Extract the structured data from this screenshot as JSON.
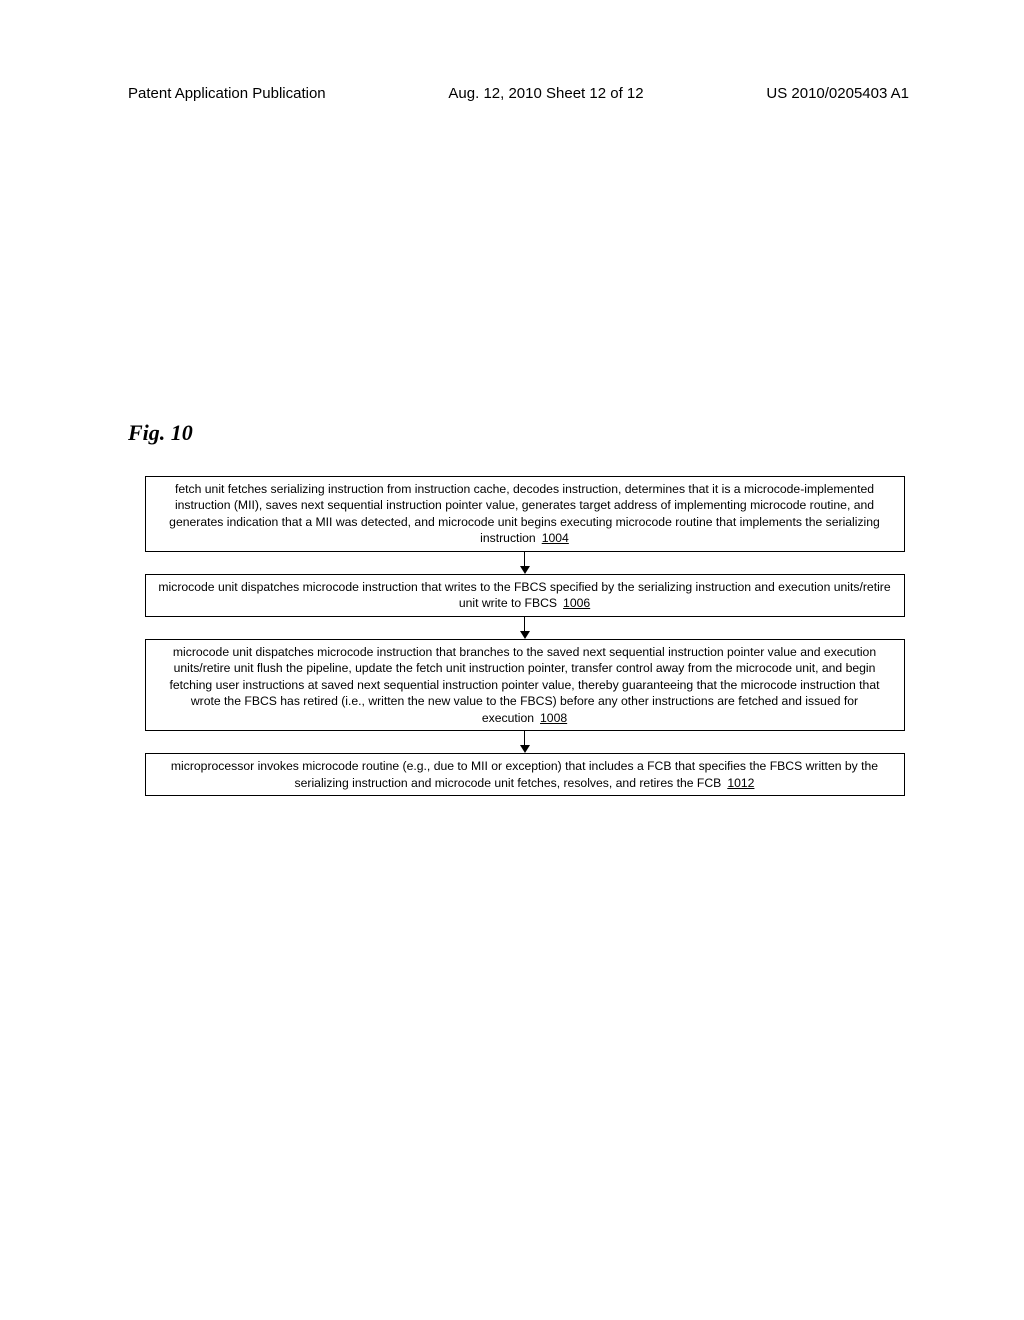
{
  "header": {
    "left": "Patent Application Publication",
    "center": "Aug. 12, 2010  Sheet 12 of 12",
    "right": "US 2010/0205403 A1"
  },
  "figure_label": "Fig. 10",
  "flowchart": {
    "boxes": [
      {
        "text": "fetch unit fetches serializing instruction from instruction cache, decodes instruction, determines that it is a microcode-implemented instruction (MII), saves next sequential instruction pointer value, generates target address of implementing microcode routine, and generates indication that a MII was detected, and microcode unit begins executing microcode routine that implements the serializing instruction",
        "ref": "1004"
      },
      {
        "text": "microcode unit dispatches microcode instruction that writes to the FBCS specified by the serializing instruction and execution units/retire unit write to FBCS",
        "ref": "1006"
      },
      {
        "text": "microcode unit dispatches microcode instruction that branches to the saved next sequential instruction pointer value and execution units/retire unit flush the pipeline, update the fetch unit instruction pointer, transfer control away from the microcode unit, and begin fetching user instructions at saved next sequential instruction pointer value, thereby guaranteeing that the microcode instruction that wrote the FBCS has retired (i.e., written the new value to the FBCS) before any other instructions are fetched and issued for execution",
        "ref": "1008"
      },
      {
        "text": "microprocessor invokes microcode routine (e.g., due to MII or exception) that includes a FCB that specifies the FBCS written by the serializing instruction and microcode unit fetches, resolves, and retires the FCB",
        "ref": "1012"
      }
    ]
  }
}
